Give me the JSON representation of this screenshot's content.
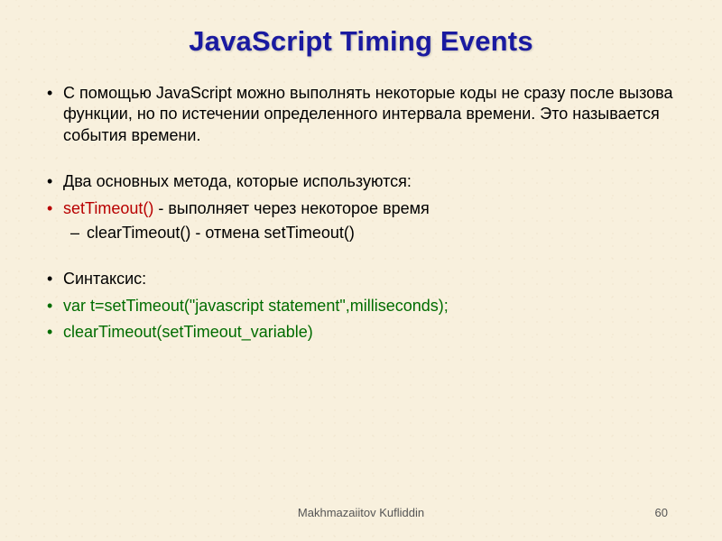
{
  "title": "JavaScript Timing Events",
  "bullets": {
    "intro": "С помощью JavaScript можно выполнять некоторые коды не сразу после вызова функции, но по истечении определенного интервала времени. Это называется события времени.",
    "methods_intro": "Два основных метода, которые используются:",
    "setTimeout": {
      "fn": "setTimeout()",
      "desc": " - выполняет через некоторое время"
    },
    "clearTimeout": {
      "fn": "clearTimeout()",
      "desc": " - отмена setTimeout()"
    },
    "syntax_label": "Синтаксис:",
    "syntax_line1": "var t=setTimeout(\"javascript statement\",milliseconds);",
    "syntax_line2": "clearTimeout(setTimeout_variable)"
  },
  "footer": {
    "author": "Makhmazaiitov Kufliddin",
    "page": "60"
  }
}
